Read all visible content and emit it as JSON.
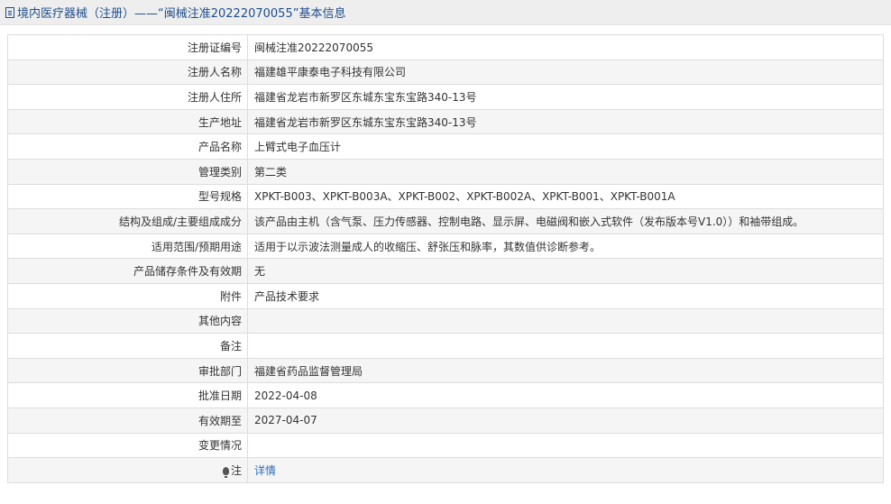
{
  "header": {
    "title": "境内医疗器械（注册）——“闽械注准20222070055”基本信息"
  },
  "rows": [
    {
      "label": "注册证编号",
      "value": "闽械注准20222070055"
    },
    {
      "label": "注册人名称",
      "value": "福建雄平康泰电子科技有限公司"
    },
    {
      "label": "注册人住所",
      "value": "福建省龙岩市新罗区东城东宝东宝路340-13号"
    },
    {
      "label": "生产地址",
      "value": "福建省龙岩市新罗区东城东宝东宝路340-13号"
    },
    {
      "label": "产品名称",
      "value": "上臂式电子血压计"
    },
    {
      "label": "管理类别",
      "value": "第二类"
    },
    {
      "label": "型号规格",
      "value": "XPKT-B003、XPKT-B003A、XPKT-B002、XPKT-B002A、XPKT-B001、XPKT-B001A"
    },
    {
      "label": "结构及组成/主要组成成分",
      "value": "该产品由主机（含气泵、压力传感器、控制电路、显示屏、电磁阀和嵌入式软件（发布版本号V1.0））和袖带组成。"
    },
    {
      "label": "适用范围/预期用途",
      "value": "适用于以示波法测量成人的收缩压、舒张压和脉率，其数值供诊断参考。"
    },
    {
      "label": "产品储存条件及有效期",
      "value": "无"
    },
    {
      "label": "附件",
      "value": "产品技术要求"
    },
    {
      "label": "其他内容",
      "value": ""
    },
    {
      "label": "备注",
      "value": ""
    },
    {
      "label": "审批部门",
      "value": "福建省药品监督管理局"
    },
    {
      "label": "批准日期",
      "value": "2022-04-08"
    },
    {
      "label": "有效期至",
      "value": "2027-04-07"
    },
    {
      "label": "变更情况",
      "value": ""
    }
  ],
  "note": {
    "label": "注",
    "link": "详情",
    "icon": "bulb-icon"
  }
}
